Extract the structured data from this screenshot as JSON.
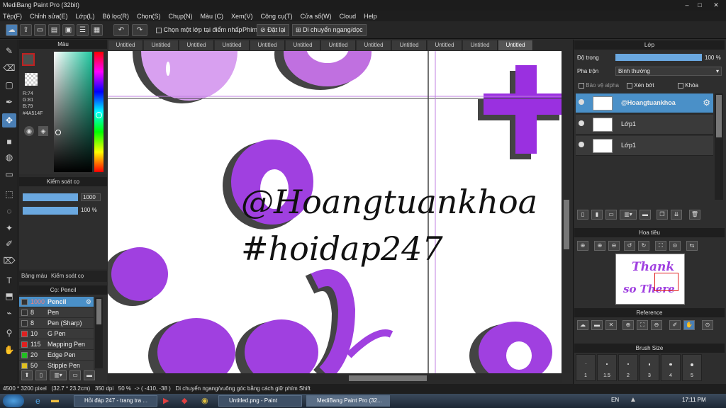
{
  "title_bar": {
    "title": "MediBang Paint Pro (32bit)"
  },
  "menu": [
    "Tệp(F)",
    "Chỉnh sửa(E)",
    "Lớp(L)",
    "Bộ lọc(R)",
    "Chọn(S)",
    "Chụp(N)",
    "Màu (C)",
    "Xem(V)",
    "Công cụ(T)",
    "Cửa sổ(W)",
    "Cloud",
    "Help"
  ],
  "toolbar": {
    "select_layer_label": "Chọn một lớp tại điểm nhấp",
    "phim_label": "Phím",
    "reset_label": "Đặt lại",
    "move_label": "Di chuyển ngang/dọc"
  },
  "color_panel": {
    "title": "Màu",
    "r": "R:74",
    "g": "G:81",
    "b": "B:79",
    "hex": "#4A514F",
    "primary_color": "#4A514F"
  },
  "brush_control": {
    "title": "Kiểm soát cọ",
    "size_value": "1000",
    "opacity_value": "100 %",
    "size_fraction": 1.0,
    "opacity_fraction": 1.0
  },
  "left_tabs": [
    "Bảng màu",
    "Kiểm soát cọ"
  ],
  "brush_panel": {
    "title": "Cọ: Pencil",
    "items": [
      {
        "size": "1000",
        "name": "Pencil",
        "color": "#333333",
        "selected": true
      },
      {
        "size": "8",
        "name": "Pen",
        "color": "#333333"
      },
      {
        "size": "8",
        "name": "Pen (Sharp)",
        "color": "#333333"
      },
      {
        "size": "10",
        "name": "G Pen",
        "color": "#e02020"
      },
      {
        "size": "115",
        "name": "Mapping Pen",
        "color": "#e02020"
      },
      {
        "size": "20",
        "name": "Edge Pen",
        "color": "#20c020"
      },
      {
        "size": "50",
        "name": "Stipple Pen",
        "color": "#e0c020"
      }
    ]
  },
  "tabs": [
    "Untitled",
    "Untitled",
    "Untitled",
    "Untitled",
    "Untitled",
    "Untitled",
    "Untitled",
    "Untitled",
    "Untitled",
    "Untitled",
    "Untitled",
    "Untitled"
  ],
  "canvas": {
    "line1": "@Hoangtuankhoa",
    "line2": "#hoidap247"
  },
  "layer_panel": {
    "title": "Lớp",
    "opacity_label": "Độ trong",
    "opacity_value": "100 %",
    "opacity_fraction": 1.0,
    "blend_label": "Pha trộn",
    "blend_value": "Bình thường",
    "protect_alpha": "Bảo vệ alpha",
    "clipping": "Xén bớt",
    "lock": "Khóa",
    "layers": [
      {
        "name": "@Hoangtuankhoa",
        "selected": true
      },
      {
        "name": "Lớp1",
        "selected": false
      },
      {
        "name": "Lớp1",
        "selected": false
      }
    ]
  },
  "navigator": {
    "title": "Hoa tiêu",
    "thumb_text_1": "Thank",
    "thumb_text_2": "so There"
  },
  "reference": {
    "title": "Reference"
  },
  "brush_size": {
    "title": "Brush Size",
    "labels": [
      "1",
      "1.5",
      "2",
      "3",
      "4",
      "5"
    ]
  },
  "status_bar": {
    "size": "4500 * 3200 pixel",
    "cm": "(32.7 * 23.2cm)",
    "dpi": "350 dpi",
    "zoom": "50 %",
    "coords": "-> ( -410, -38 )",
    "hint": "Di chuyển ngang/vuông góc bằng cách giữ phím Shift"
  },
  "taskbar": {
    "tasks": [
      "Hỏi đáp 247 - trang tra ...",
      "Untitled.png - Paint",
      "MediBang Paint Pro (32..."
    ],
    "lang": "EN",
    "time": "17:11 PM"
  },
  "colors": {
    "accent": "#4a90c8",
    "purple": "#a040e0",
    "light_purple": "#d8a0f0"
  }
}
